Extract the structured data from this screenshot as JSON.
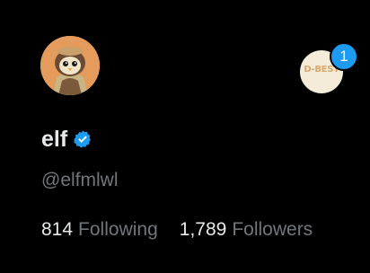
{
  "profile": {
    "display_name": "elf",
    "handle": "@elfmlwl",
    "avatar_icon": "owl-character-avatar",
    "verified_icon": "verified-badge-icon"
  },
  "account_switcher": {
    "logo_text": "D-BEST",
    "notification_count": "1"
  },
  "stats": {
    "following_count": "814",
    "following_label": "Following",
    "followers_count": "1,789",
    "followers_label": "Followers"
  },
  "colors": {
    "background": "#000000",
    "primary_text": "#e7e9ea",
    "secondary_text": "#71767b",
    "accent": "#1d9bf0"
  }
}
